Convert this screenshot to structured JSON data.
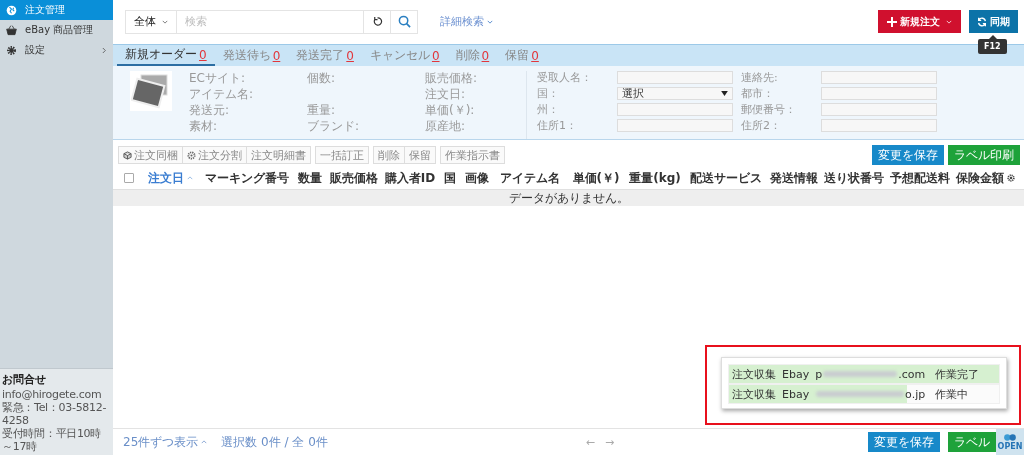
{
  "sidebar": {
    "items": [
      {
        "label": "注文管理",
        "selected": true,
        "has_submenu": false
      },
      {
        "label": "eBay 商品管理",
        "selected": false,
        "has_submenu": false
      },
      {
        "label": "設定",
        "selected": false,
        "has_submenu": true
      }
    ],
    "contact": {
      "title": "お問合せ",
      "lines": [
        "info@hirogete.com",
        "緊急：Tel：03-5812-4258",
        "受付時間：平日10時～17時"
      ]
    }
  },
  "search": {
    "scope": "全体",
    "placeholder": "検索",
    "advanced": "詳細検索"
  },
  "actions": {
    "new_order": "新規注文",
    "sync": "同期",
    "sync_tooltip": "F12"
  },
  "tabs": [
    {
      "label": "新規オーダー",
      "count": "0",
      "selected": true
    },
    {
      "label": "発送待ち",
      "count": "0",
      "selected": false
    },
    {
      "label": "発送完了",
      "count": "0",
      "selected": false
    },
    {
      "label": "キャンセル",
      "count": "0",
      "selected": false
    },
    {
      "label": "削除",
      "count": "0",
      "selected": false
    },
    {
      "label": "保留",
      "count": "0",
      "selected": false
    }
  ],
  "details": {
    "columns": [
      [
        "ECサイト:",
        "アイテム名:",
        "発送元:",
        "素材:"
      ],
      [
        "個数:",
        "",
        "重量:",
        "ブランド:"
      ],
      [
        "販売価格:",
        "注文日:",
        "単価(￥):",
        "原産地:"
      ]
    ],
    "form": [
      {
        "label": "受取人名：",
        "kind": "text"
      },
      {
        "label": "連絡先:",
        "kind": "text"
      },
      {
        "label": "国：",
        "kind": "select",
        "value": "選択"
      },
      {
        "label": "都市：",
        "kind": "text"
      },
      {
        "label": "州：",
        "kind": "text"
      },
      {
        "label": "郵便番号：",
        "kind": "text"
      },
      {
        "label": "住所1：",
        "kind": "text"
      },
      {
        "label": "住所2：",
        "kind": "text"
      }
    ]
  },
  "toolbar": [
    "注文同梱",
    "注文分割",
    "注文明細書",
    "一括訂正",
    "削除",
    "保留",
    "作業指示書"
  ],
  "toolbar_right": [
    "変更を保存",
    "ラベル印刷"
  ],
  "table": {
    "select_all_checked": false,
    "columns": [
      {
        "label": "注文日",
        "sorted": true
      },
      {
        "label": "マーキング番号",
        "sorted": false
      },
      {
        "label": "数量",
        "sorted": false
      },
      {
        "label": "販売価格",
        "sorted": false
      },
      {
        "label": "購入者ID",
        "sorted": false
      },
      {
        "label": "国",
        "sorted": false
      },
      {
        "label": "画像",
        "sorted": false
      },
      {
        "label": "アイテム名",
        "sorted": false
      },
      {
        "label": "単価(￥)",
        "sorted": false
      },
      {
        "label": "重量(kg)",
        "sorted": false
      },
      {
        "label": "配送サービス",
        "sorted": false
      },
      {
        "label": "発送情報",
        "sorted": false
      },
      {
        "label": "送り状番号",
        "sorted": false
      },
      {
        "label": "予想配送料",
        "sorted": false
      },
      {
        "label": "保険金額",
        "sorted": false
      }
    ],
    "empty": "データがありません。"
  },
  "jobs": [
    {
      "task": "注文収集",
      "site": "Ebay",
      "account_start": "p",
      "account_end": ".com",
      "status": "作業完了",
      "level": 1
    },
    {
      "task": "注文収集",
      "site": "Ebay",
      "account_end": "o.jp",
      "status": "作業中",
      "level": 0.66
    }
  ],
  "footer": {
    "page_size": "25件ずつ表示",
    "selection": "選択数 0件 / 全 0件",
    "prev": "←",
    "next": "→",
    "buttons": [
      "変更を保存",
      "ラベル"
    ],
    "badge": "OPEN"
  }
}
